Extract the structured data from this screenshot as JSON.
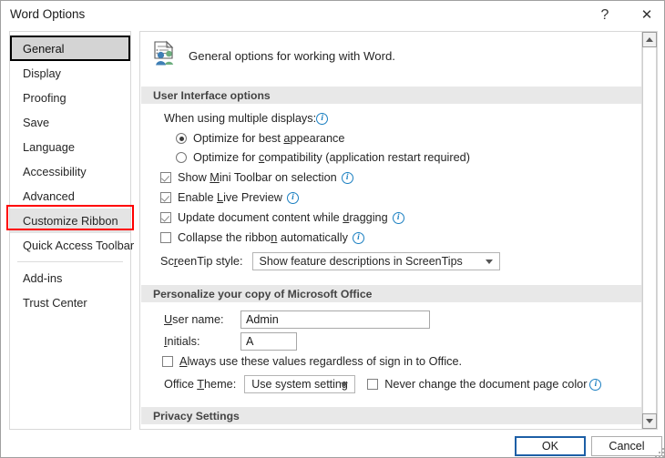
{
  "window": {
    "title": "Word Options",
    "help_label": "?",
    "close_label": "✕"
  },
  "sidebar": {
    "items": [
      {
        "label": "General",
        "state": "selected"
      },
      {
        "label": "Display",
        "state": "normal"
      },
      {
        "label": "Proofing",
        "state": "normal"
      },
      {
        "label": "Save",
        "state": "normal"
      },
      {
        "label": "Language",
        "state": "normal"
      },
      {
        "label": "Accessibility",
        "state": "normal"
      },
      {
        "label": "Advanced",
        "state": "normal"
      },
      {
        "label": "Customize Ribbon",
        "state": "hovered"
      },
      {
        "label": "Quick Access Toolbar",
        "state": "normal"
      },
      {
        "label": "Add-ins",
        "state": "normal"
      },
      {
        "label": "Trust Center",
        "state": "normal"
      }
    ],
    "highlight_color": "#ff0000"
  },
  "panel": {
    "header_text": "General options for working with Word.",
    "header_icon": "document-people-icon",
    "sections": {
      "user_interface": {
        "title": "User Interface options",
        "multiple_displays_label": "When using multiple displays:",
        "radios": [
          {
            "label_before": "Optimize for best ",
            "accel": "a",
            "label_after": "ppearance",
            "selected": true
          },
          {
            "label_before": "Optimize for ",
            "accel": "c",
            "label_after": "ompatibility (application restart required)",
            "selected": false
          }
        ],
        "checkboxes": [
          {
            "label_before": "Show ",
            "accel": "M",
            "label_after": "ini Toolbar on selection",
            "checked": true,
            "info": true
          },
          {
            "label_before": "Enable ",
            "accel": "L",
            "label_after": "ive Preview",
            "checked": true,
            "info": true
          },
          {
            "label_before": "Update document content while ",
            "accel": "d",
            "label_after": "ragging",
            "checked": true,
            "info": true
          },
          {
            "label_before": "Collapse the ribbo",
            "accel": "n",
            "label_after": " automatically",
            "checked": false,
            "info": true
          }
        ],
        "screentip_label_before": "Sc",
        "screentip_accel": "r",
        "screentip_label_after": "eenTip style:",
        "screentip_value": "Show feature descriptions in ScreenTips"
      },
      "personalize": {
        "title": "Personalize your copy of Microsoft Office",
        "username_label_accel": "U",
        "username_label_after": "ser name:",
        "username_value": "Admin",
        "initials_label_accel": "I",
        "initials_label_after": "nitials:",
        "initials_value": "A",
        "always_use_accel": "A",
        "always_use_label_after": "lways use these values regardless of sign in to Office.",
        "always_use_checked": false,
        "theme_label_before": "Office ",
        "theme_label_accel": "T",
        "theme_label_after": "heme:",
        "theme_value": "Use system setting",
        "never_change_label": "Never change the document page color",
        "never_change_checked": false
      },
      "privacy": {
        "title": "Privacy Settings"
      }
    }
  },
  "scrollbar": {
    "up_label": "scroll-up",
    "down_label": "scroll-down"
  },
  "footer": {
    "ok_label": "OK",
    "cancel_label": "Cancel",
    "ok_focus_color": "#1d5fa6"
  }
}
